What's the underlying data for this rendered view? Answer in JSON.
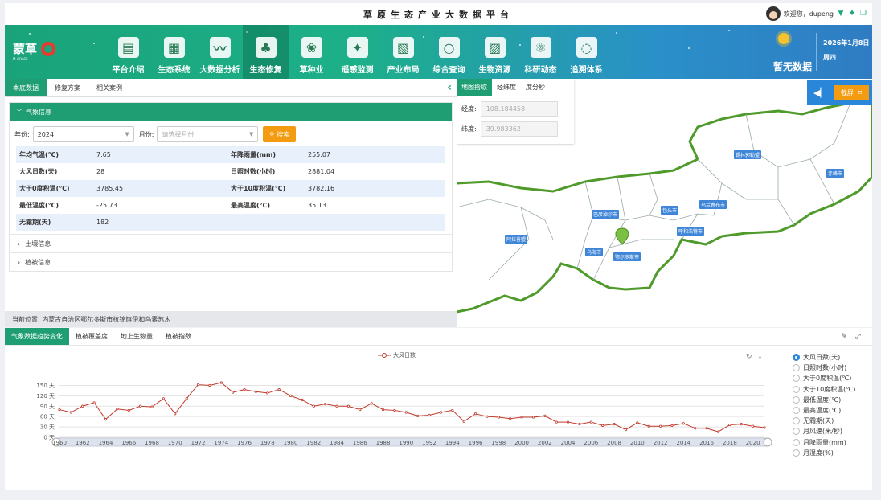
{
  "top": {
    "title": "草原生态产业大数据平台",
    "welcome": "欢迎您，dupeng"
  },
  "brand": {
    "name": "蒙草",
    "sub": "M-GRASS",
    "ring_color": "#e83b2d"
  },
  "nav": [
    {
      "label": "平台介绍",
      "icon": "book-icon"
    },
    {
      "label": "生态系统",
      "icon": "grassland-icon"
    },
    {
      "label": "大数据分析",
      "icon": "chart-icon"
    },
    {
      "label": "生态修复",
      "icon": "tree-icon"
    },
    {
      "label": "草种业",
      "icon": "sprout-icon"
    },
    {
      "label": "遥感监测",
      "icon": "satellite-icon"
    },
    {
      "label": "产业布局",
      "icon": "certificate-icon"
    },
    {
      "label": "综合查询",
      "icon": "magnifier-icon"
    },
    {
      "label": "生物资源",
      "icon": "picture-icon"
    },
    {
      "label": "科研动态",
      "icon": "atom-icon"
    },
    {
      "label": "追溯体系",
      "icon": "cycle-icon"
    }
  ],
  "weather": {
    "text": "暂无数据",
    "date": "2026年1月8日",
    "weekday": "周四"
  },
  "left": {
    "tabs": [
      "本底数据",
      "修复方案",
      "相关案例"
    ],
    "card_title": "气象信息",
    "year_label": "年份:",
    "year_value": "2024",
    "month_label": "月份:",
    "month_placeholder": "请选择月份",
    "search_label": "搜索",
    "rows": [
      {
        "k1": "年均气温(℃)",
        "v1": "7.65",
        "k2": "年降雨量(mm)",
        "v2": "255.07"
      },
      {
        "k1": "大风日数(天)",
        "v1": "28",
        "k2": "日照时数(小时)",
        "v2": "2881.04"
      },
      {
        "k1": "大于0度积温(℃)",
        "v1": "3785.45",
        "k2": "大于10度积温(℃)",
        "v2": "3782.16"
      },
      {
        "k1": "最低温度(℃)",
        "v1": "-25.73",
        "k2": "最高温度(℃)",
        "v2": "35.13"
      },
      {
        "k1": "无霜期(天)",
        "v1": "182",
        "k2": "",
        "v2": ""
      }
    ],
    "soil": "土壤信息",
    "vegetation": "植被信息",
    "location": "当前位置:  内蒙古自治区鄂尔多斯市杭锦旗伊和乌素苏木"
  },
  "map": {
    "pick_tabs": [
      "地图拾取",
      "经纬度",
      "度分秒"
    ],
    "lng_label": "经度:",
    "lng_value": "108.184458",
    "lat_label": "纬度:",
    "lat_value": "39.983362",
    "screenshot_label": "截屏",
    "cities": [
      "锡林郭勒盟",
      "赤峰市",
      "乌兰察布市",
      "包头市",
      "巴彦淖尔市",
      "呼和浩特市",
      "阿拉善盟",
      "乌海市",
      "鄂尔多斯市"
    ]
  },
  "bottom": {
    "tabs": [
      "气象数据趋势变化",
      "植被覆盖度",
      "地上生物量",
      "植被指数"
    ],
    "radios": [
      "大风日数(天)",
      "日照时数(小时)",
      "大于0度积温(℃)",
      "大于10度积温(℃)",
      "最低温度(℃)",
      "最高温度(℃)",
      "无霜期(天)",
      "月风速(米/秒)",
      "月降雨量(mm)",
      "月湿度(%)"
    ],
    "selected_radio": 0
  },
  "chart_data": {
    "type": "line",
    "title": "",
    "xlabel": "",
    "ylabel": "",
    "series": [
      {
        "name": "大风日数",
        "color": "#c0392b"
      }
    ],
    "x": [
      1960,
      1961,
      1962,
      1963,
      1964,
      1965,
      1966,
      1967,
      1968,
      1969,
      1970,
      1971,
      1972,
      1973,
      1974,
      1975,
      1976,
      1977,
      1978,
      1979,
      1980,
      1981,
      1982,
      1983,
      1984,
      1985,
      1986,
      1987,
      1988,
      1989,
      1990,
      1991,
      1992,
      1993,
      1994,
      1995,
      1996,
      1997,
      1998,
      1999,
      2000,
      2001,
      2002,
      2003,
      2004,
      2005,
      2006,
      2007,
      2008,
      2009,
      2010,
      2011,
      2012,
      2013,
      2014,
      2015,
      2016,
      2017,
      2018,
      2019,
      2020,
      2021
    ],
    "values": [
      80,
      72,
      90,
      100,
      52,
      82,
      78,
      90,
      88,
      112,
      68,
      112,
      152,
      150,
      158,
      130,
      138,
      132,
      128,
      138,
      120,
      108,
      90,
      96,
      90,
      90,
      80,
      98,
      80,
      78,
      72,
      62,
      64,
      72,
      78,
      46,
      68,
      60,
      58,
      54,
      58,
      58,
      62,
      44,
      44,
      38,
      44,
      34,
      38,
      22,
      42,
      32,
      32,
      34,
      40,
      26,
      26,
      16,
      36,
      38,
      32,
      28
    ],
    "yticks": [
      0,
      30,
      60,
      90,
      120,
      150
    ],
    "ytick_labels": [
      "0 天",
      "30 天",
      "60 天",
      "90 天",
      "120 天",
      "150 天"
    ],
    "xtick_labels": [
      "1960",
      "1962",
      "1964",
      "1966",
      "1968",
      "1970",
      "1972",
      "1974",
      "1976",
      "1978",
      "1980",
      "1982",
      "1984",
      "1986",
      "1988",
      "1990",
      "1992",
      "1994",
      "1996",
      "1998",
      "2000",
      "2002",
      "2004",
      "2006",
      "2008",
      "2010",
      "2012",
      "2014",
      "2016",
      "2018",
      "2020"
    ],
    "ylim": [
      0,
      165
    ],
    "grid": true,
    "legend": "top-center"
  }
}
